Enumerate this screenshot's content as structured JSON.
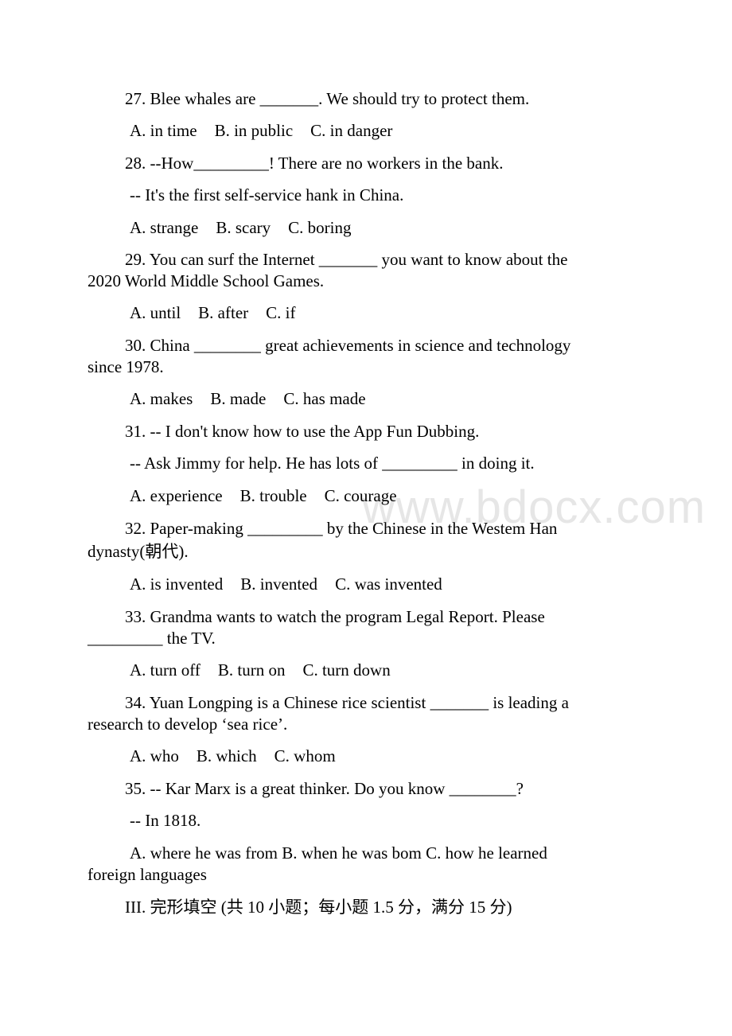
{
  "watermark": "www.bdocx.com",
  "questions": {
    "q27": {
      "stem": "27. Blee whales are _______. We should try to protect them.",
      "options": [
        "A. in time",
        "B. in public",
        "C. in danger"
      ]
    },
    "q28": {
      "stem": "28. --How_________! There are no workers in the bank.",
      "reply": "-- It's the first self-service hank in China.",
      "options": [
        "A. strange",
        "B. scary",
        "C. boring"
      ]
    },
    "q29": {
      "stem_line1": "29. You can surf the Internet _______ you want to know about the",
      "stem_line2": "2020 World Middle School Games.",
      "options": [
        "A. until",
        "B. after",
        "C. if"
      ]
    },
    "q30": {
      "stem_line1": "30. China ________ great achievements in science and technology",
      "stem_line2": "since 1978.",
      "options": [
        "A. makes",
        "B. made",
        "C. has made"
      ]
    },
    "q31": {
      "stem": "31. -- I don't know how to use the App Fun Dubbing.",
      "reply": "-- Ask Jimmy for help. He has lots of _________ in doing it.",
      "options": [
        "A. experience",
        "B. trouble",
        "C. courage"
      ]
    },
    "q32": {
      "stem_line1": "32. Paper-making _________ by the Chinese in the Westem Han",
      "stem_line2": "dynasty(朝代).",
      "options": [
        "A. is invented",
        "B. invented",
        "C. was invented"
      ]
    },
    "q33": {
      "stem_line1": "33. Grandma wants to watch the program Legal Report. Please",
      "stem_line2": "_________ the TV.",
      "options": [
        "A. turn off",
        "B. turn on",
        "C. turn down"
      ]
    },
    "q34": {
      "stem_line1": "34. Yuan Longping is a Chinese rice scientist _______ is leading a",
      "stem_line2": "research to develop ‘sea rice’.",
      "options": [
        "A. who",
        "B. which",
        "C. whom"
      ]
    },
    "q35": {
      "stem": "35. -- Kar Marx is a great thinker. Do you know ________?",
      "reply": "-- In 1818.",
      "options_line1": "A. where he was from B. when he was bom C. how he learned",
      "options_line2": "foreign languages"
    }
  },
  "section_heading": "III. 完形填空 (共 10 小题；每小题 1.5 分，满分 15 分)"
}
